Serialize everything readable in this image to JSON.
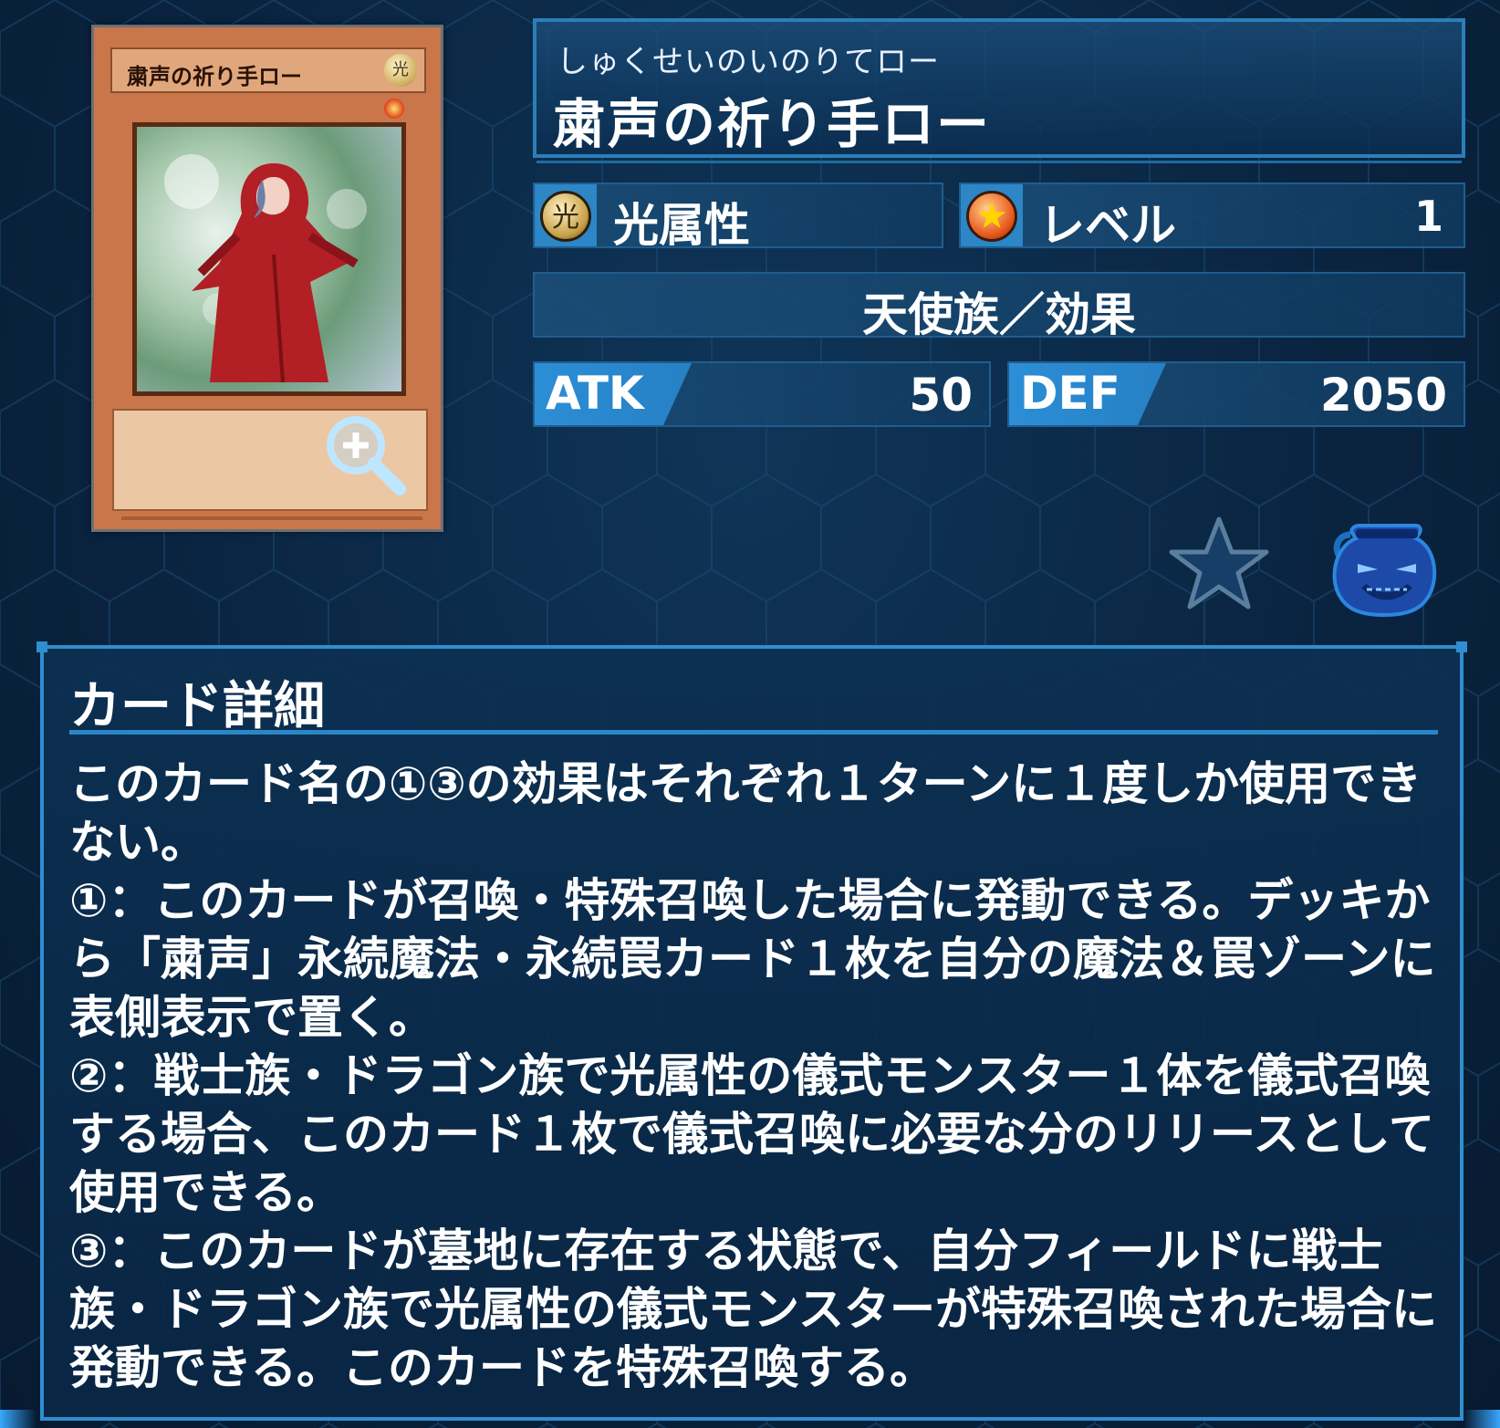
{
  "card_image": {
    "name_text": "粛声の祈り手ロー",
    "attribute_glyph": "光"
  },
  "name_panel": {
    "ruby": "しゅくせいのいのりてロー",
    "title": "粛声の祈り手ロー"
  },
  "attribute": {
    "icon_glyph": "光",
    "label": "光属性"
  },
  "level": {
    "icon_glyph": "★",
    "label": "レベル",
    "value": "1"
  },
  "type_line": "天使族／効果",
  "atk": {
    "label": "ATK",
    "value": "50"
  },
  "def": {
    "label": "DEF",
    "value": "2050"
  },
  "icons": {
    "zoom": "zoom-in-icon",
    "favorite": "star-icon",
    "pot": "pot-of-greed-icon"
  },
  "colors": {
    "accent": "#2f8ed0",
    "panel": "#0c3052",
    "background": "#0a2440"
  },
  "detail": {
    "title": "カード詳細",
    "description": "このカード名の①③の効果はそれぞれ１ターンに１度しか使用できない。\n①：このカードが召喚・特殊召喚した場合に発動できる。デッキから「粛声」永続魔法・永続罠カード１枚を自分の魔法＆罠ゾーンに表側表示で置く。\n②：戦士族・ドラゴン族で光属性の儀式モンスター１体を儀式召喚する場合、このカード１枚で儀式召喚に必要な分のリリースとして使用できる。\n③：このカードが墓地に存在する状態で、自分フィールドに戦士族・ドラゴン族で光属性の儀式モンスターが特殊召喚された場合に発動できる。このカードを特殊召喚する。"
  }
}
